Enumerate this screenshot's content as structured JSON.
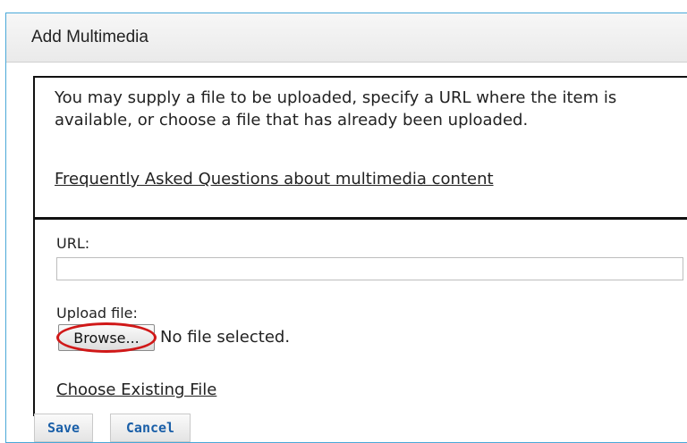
{
  "dialog": {
    "title": "Add Multimedia"
  },
  "info": {
    "text": "You may supply a file to be uploaded, specify a URL where the item is available, or choose a file that has already been uploaded.",
    "faq_link": "Frequently Asked Questions about multimedia content"
  },
  "form": {
    "url_label": "URL:",
    "url_value": "",
    "upload_label": "Upload file:",
    "browse_label": "Browse...",
    "no_file_text": "No file selected.",
    "choose_existing_link": "Choose Existing File"
  },
  "actions": {
    "save_label": "Save",
    "cancel_label": "Cancel"
  },
  "colors": {
    "accent": "#1a5fa8",
    "highlight": "#d01818",
    "dialog_border": "#4aa8d8"
  }
}
